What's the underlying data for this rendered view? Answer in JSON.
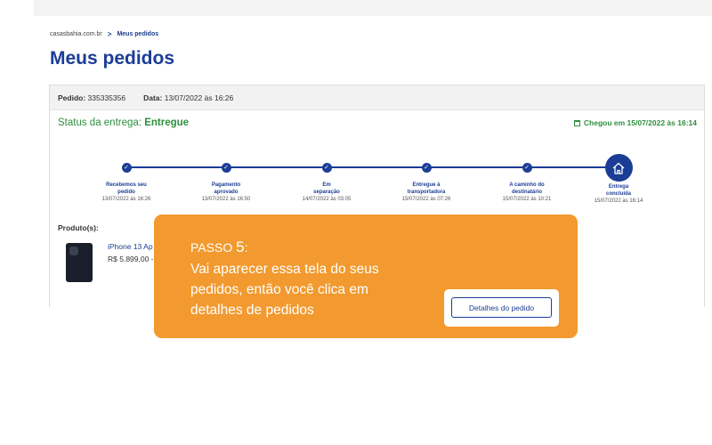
{
  "breadcrumb": {
    "home": "casasbahia.com.br",
    "separator": ">",
    "current": "Meus pedidos"
  },
  "page": {
    "title": "Meus pedidos"
  },
  "order": {
    "number_label": "Pedido:",
    "number": "335335356",
    "date_label": "Data:",
    "date": "13/07/2022 às 16:26",
    "status_label": "Status da entrega:",
    "status": "Entregue",
    "arrived": "Chegou em 15/07/2022 às 16:14"
  },
  "tracking": {
    "steps": [
      {
        "label_1": "Recebemos seu",
        "label_2": "pedido",
        "date": "13/07/2022 às 16:26"
      },
      {
        "label_1": "Pagamento",
        "label_2": "aprovado",
        "date": "13/07/2022 às 16:50"
      },
      {
        "label_1": "Em",
        "label_2": "separação",
        "date": "14/07/2022 às 03:05"
      },
      {
        "label_1": "Entregue à",
        "label_2": "transportadora",
        "date": "15/07/2022 às 07:26"
      },
      {
        "label_1": "A caminho do",
        "label_2": "destinatário",
        "date": "15/07/2022 às 10:21"
      },
      {
        "label_1": "Entrega",
        "label_2": "concluída",
        "date": "15/07/2022 às 16:14"
      }
    ]
  },
  "products": {
    "label": "Produto(s):",
    "items": [
      {
        "name": "iPhone 13 Ap",
        "price": "R$ 5.899,00 -"
      }
    ]
  },
  "overlay": {
    "step_word": "PASSO",
    "step_number": "5",
    "step_colon": ":",
    "text": "Vai aparecer essa tela do seus pedidos, então você clica em detalhes de pedidos",
    "button_label": "Detalhes do pedido"
  },
  "colors": {
    "brand_blue": "#1b3d95",
    "success_green": "#2f8f3e",
    "overlay_orange": "#f29a2f"
  },
  "icons": {
    "step": "check-icon",
    "final_step": "home-icon",
    "arrived": "calendar-icon"
  }
}
